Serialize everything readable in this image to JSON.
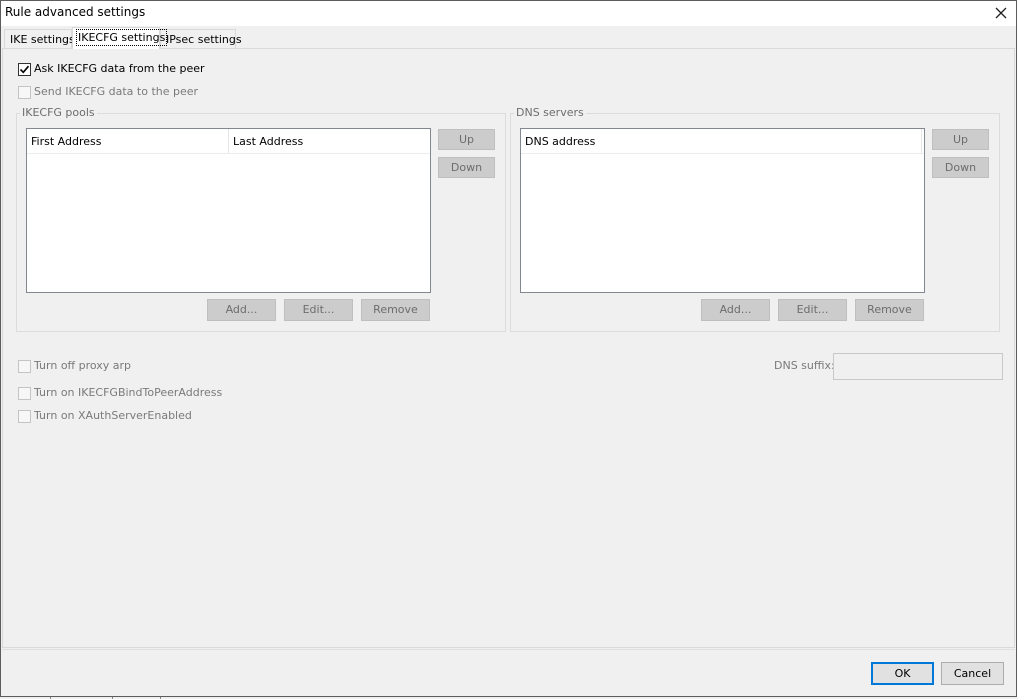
{
  "window": {
    "title": "Rule advanced settings",
    "close_glyph": "✕"
  },
  "tabs": [
    {
      "label": "IKE settings",
      "active": false
    },
    {
      "label": "IKECFG settings",
      "active": true
    },
    {
      "label": "IPsec settings",
      "active": false
    }
  ],
  "options": {
    "ask_ikecfg": {
      "label": "Ask IKECFG data from the peer",
      "checked": true,
      "enabled": true
    },
    "send_ikecfg": {
      "label": "Send IKECFG data to the peer",
      "checked": false,
      "enabled": false
    }
  },
  "ikecfg_pools": {
    "title": "IKECFG pools",
    "columns": [
      "First Address",
      "Last Address"
    ],
    "rows": [],
    "buttons": {
      "up": "Up",
      "down": "Down",
      "add": "Add...",
      "edit": "Edit...",
      "remove": "Remove"
    }
  },
  "dns_servers": {
    "title": "DNS servers",
    "columns": [
      "DNS address"
    ],
    "rows": [],
    "buttons": {
      "up": "Up",
      "down": "Down",
      "add": "Add...",
      "edit": "Edit...",
      "remove": "Remove"
    }
  },
  "extra_options": {
    "proxy_arp": {
      "label": "Turn off proxy arp",
      "checked": false,
      "enabled": false
    },
    "bind_to_peer": {
      "label": "Turn on IKECFGBindToPeerAddress",
      "checked": false,
      "enabled": false
    },
    "xauth_server": {
      "label": "Turn on XAuthServerEnabled",
      "checked": false,
      "enabled": false
    }
  },
  "dns_suffix": {
    "label": "DNS suffix:",
    "value": "",
    "enabled": false
  },
  "footer": {
    "ok_label": "OK",
    "cancel_label": "Cancel"
  },
  "colors": {
    "dialog_bg": "#f0f0f0",
    "accent": "#0078d7",
    "disabled_text": "#6d6d6d"
  }
}
